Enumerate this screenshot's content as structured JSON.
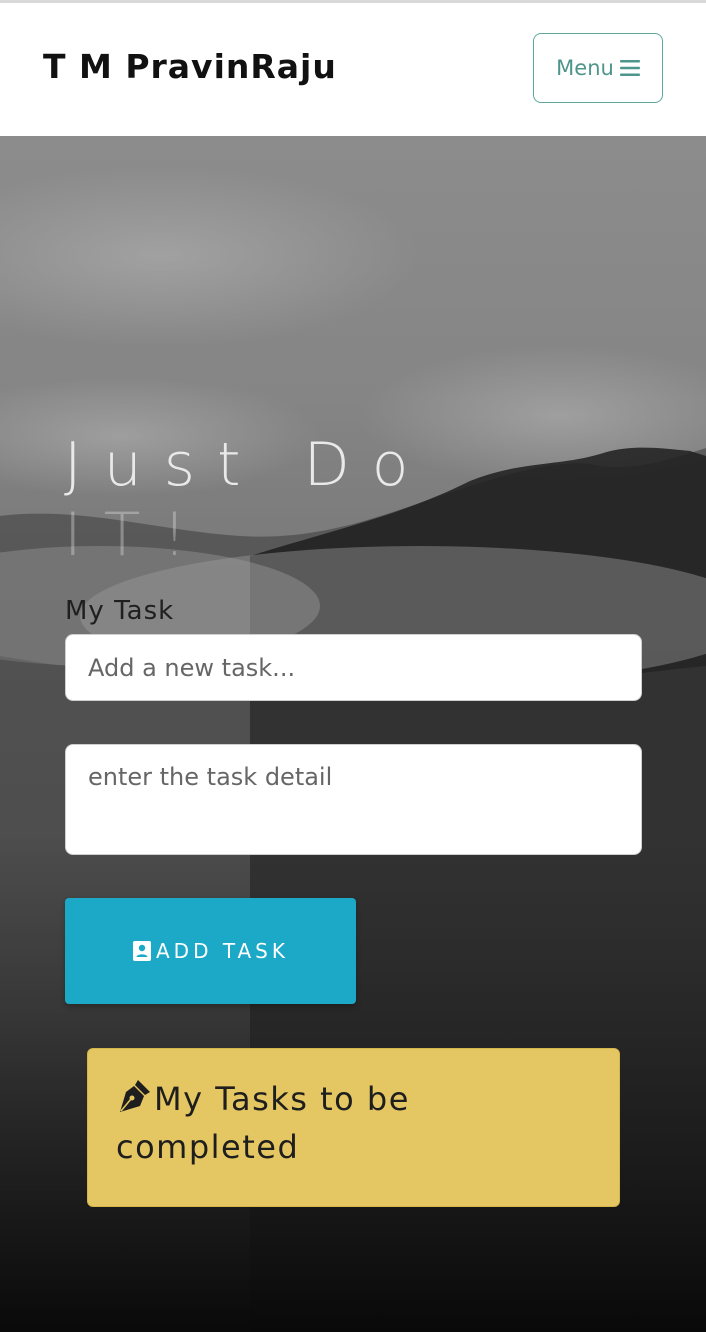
{
  "header": {
    "brand": "T M PravinRaju",
    "menu_label": "Menu",
    "menu_icon": "hamburger-icon"
  },
  "hero": {
    "headline_line1": "Just Do",
    "headline_line2": "IT!",
    "task_label": "My Task",
    "task_input": {
      "placeholder": "Add a new task...",
      "value": ""
    },
    "detail_input": {
      "placeholder": "enter the task detail",
      "value": ""
    },
    "add_button": {
      "label": "ADD TASK",
      "icon": "contact-card-icon"
    }
  },
  "tasks_panel": {
    "title": "My Tasks to be completed",
    "icon": "pen-nib-icon"
  },
  "colors": {
    "accent_teal": "#5fa59c",
    "button_blue": "#1ca9c7",
    "card_yellow": "#e4c662"
  }
}
